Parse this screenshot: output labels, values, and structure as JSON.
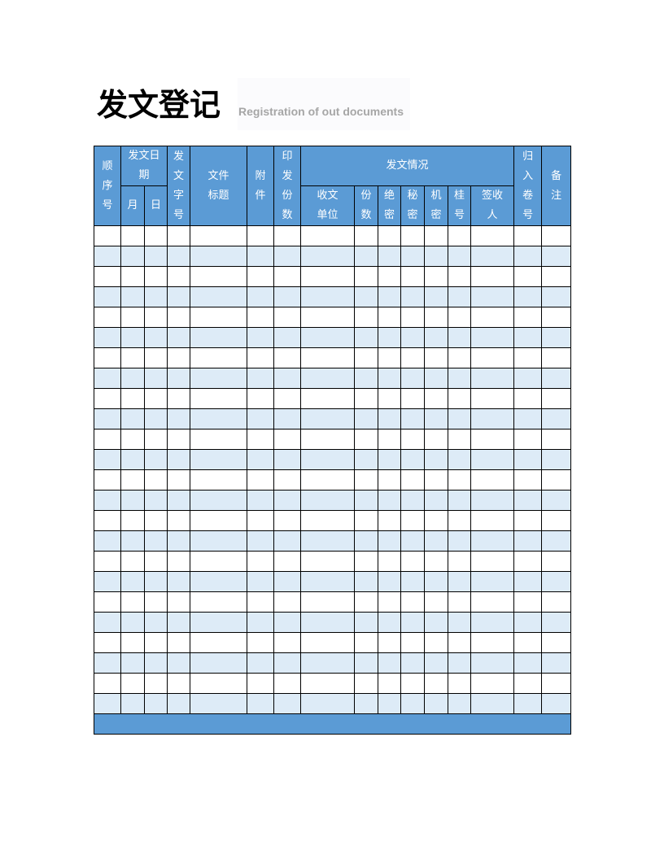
{
  "title": "发文登记",
  "subtitle": "Registration of out documents",
  "header": {
    "seq": "顺序号",
    "date_group": "发文日期",
    "month": "月",
    "day": "日",
    "doc_no": "发文字号",
    "file_title": [
      "文件",
      "标题"
    ],
    "attachment": "附件",
    "copies_printed": "印发份数",
    "dispatch_group": "发文情况",
    "recipient_unit": [
      "收文",
      "单位"
    ],
    "copies": "份数",
    "top_secret": "绝密",
    "secret": "秘密",
    "confidential": "机密",
    "registered": "桂号",
    "signee": [
      "签收",
      "人"
    ],
    "archive_no": "归入卷号",
    "remarks": "备注"
  },
  "rows": 24,
  "colors": {
    "header": "#5b9bd5",
    "stripe": "#ddebf7"
  }
}
